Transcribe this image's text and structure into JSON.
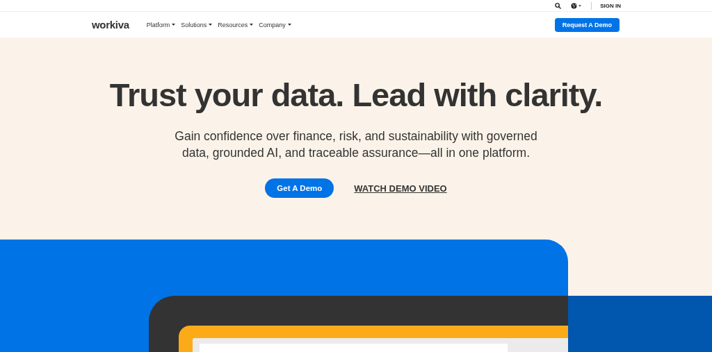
{
  "utility_bar": {
    "sign_in": "SIGN IN"
  },
  "nav": {
    "logo": "workiva",
    "items": [
      {
        "label": "Platform"
      },
      {
        "label": "Solutions"
      },
      {
        "label": "Resources"
      },
      {
        "label": "Company"
      }
    ],
    "cta": "Request A Demo"
  },
  "hero": {
    "title": "Trust your data. Lead with clarity.",
    "subtitle": "Gain confidence over finance, risk, and sustainability with governed data, grounded AI, and traceable assurance—all in one platform.",
    "primary_button": "Get A Demo",
    "secondary_link": "WATCH DEMO VIDEO"
  }
}
